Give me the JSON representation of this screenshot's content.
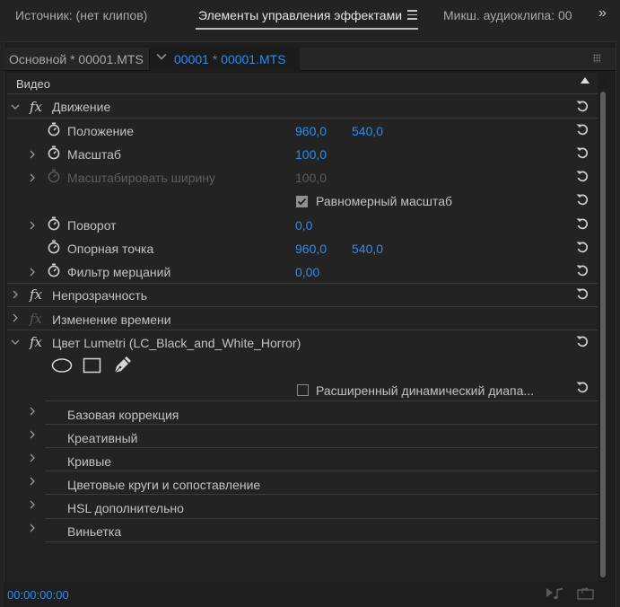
{
  "tabs": {
    "source": "Источник: (нет клипов)",
    "effect_controls": "Элементы управления эффектами",
    "audio_mixer": "Микш. аудиоклипа: 00",
    "more": "»"
  },
  "clip_bar": {
    "master": "Основной * 00001.MTS",
    "sequence_clip": "00001 * 00001.MTS"
  },
  "section_header": "Видео",
  "effects": {
    "motion": {
      "name": "Движение",
      "position": {
        "label": "Положение",
        "x": "960,0",
        "y": "540,0"
      },
      "scale": {
        "label": "Масштаб",
        "value": "100,0"
      },
      "scale_width": {
        "label": "Масштабировать ширину",
        "value": "100,0"
      },
      "uniform_scale": {
        "label": "Равномерный масштаб",
        "checked": true
      },
      "rotation": {
        "label": "Поворот",
        "value": "0,0"
      },
      "anchor": {
        "label": "Опорная точка",
        "x": "960,0",
        "y": "540,0"
      },
      "flicker": {
        "label": "Фильтр мерцаний",
        "value": "0,00"
      }
    },
    "opacity": {
      "name": "Непрозрачность"
    },
    "time_remap": {
      "name": "Изменение времени"
    },
    "lumetri": {
      "name": "Цвет Lumetri (LC_Black_and_White_Horror)",
      "hdr_label": "Расширенный динамический диапа...",
      "hdr_checked": false,
      "sections": [
        "Базовая коррекция",
        "Креативный",
        "Кривые",
        "Цветовые круги и сопоставление",
        "HSL дополнительно",
        "Виньетка"
      ]
    }
  },
  "icons": {
    "fx": "fx",
    "stopwatch": "stopwatch-icon",
    "reset": "reset-icon",
    "ellipse_mask": "ellipse-mask-icon",
    "rect_mask": "rectangle-mask-icon",
    "pen_mask": "pen-mask-icon"
  },
  "timecode": "00:00:00:00",
  "colors": {
    "accent_blue": "#2d8ceb",
    "panel_bg": "#232323"
  }
}
